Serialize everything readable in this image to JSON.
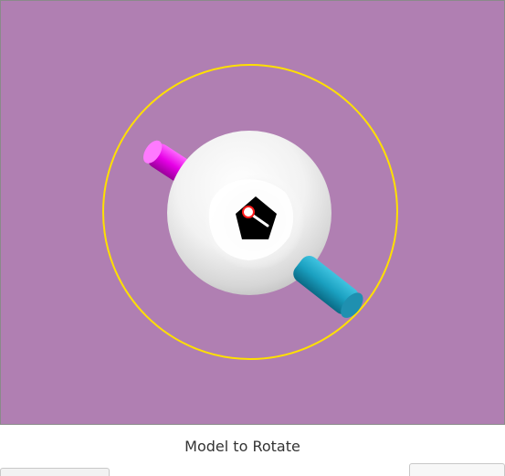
{
  "viewport": {
    "background_color": "#b07fb2",
    "model": {
      "ring_color": "#ffe000",
      "sphere_color": "#ffffff",
      "handle_magenta_color": "#e600e6",
      "handle_cyan_color": "#1aa0c0",
      "center_pentagon_color": "#000000",
      "pivot_marker_color": "#ff1a1a"
    }
  },
  "caption": {
    "text": "Model to Rotate"
  }
}
